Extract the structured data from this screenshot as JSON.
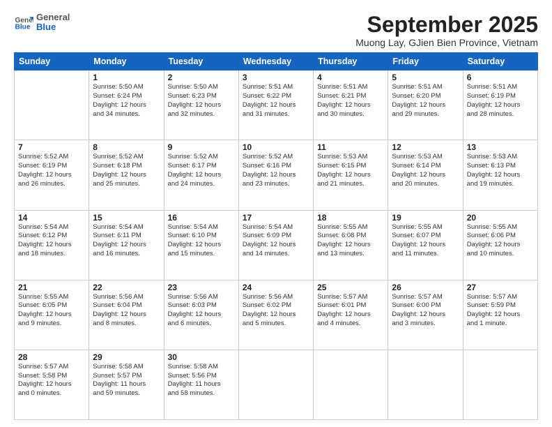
{
  "header": {
    "logo": {
      "general": "General",
      "blue": "Blue"
    },
    "title": "September 2025",
    "location": "Muong Lay, GJien Bien Province, Vietnam"
  },
  "weekdays": [
    "Sunday",
    "Monday",
    "Tuesday",
    "Wednesday",
    "Thursday",
    "Friday",
    "Saturday"
  ],
  "weeks": [
    [
      {
        "day": "",
        "lines": []
      },
      {
        "day": "1",
        "lines": [
          "Sunrise: 5:50 AM",
          "Sunset: 6:24 PM",
          "Daylight: 12 hours",
          "and 34 minutes."
        ]
      },
      {
        "day": "2",
        "lines": [
          "Sunrise: 5:50 AM",
          "Sunset: 6:23 PM",
          "Daylight: 12 hours",
          "and 32 minutes."
        ]
      },
      {
        "day": "3",
        "lines": [
          "Sunrise: 5:51 AM",
          "Sunset: 6:22 PM",
          "Daylight: 12 hours",
          "and 31 minutes."
        ]
      },
      {
        "day": "4",
        "lines": [
          "Sunrise: 5:51 AM",
          "Sunset: 6:21 PM",
          "Daylight: 12 hours",
          "and 30 minutes."
        ]
      },
      {
        "day": "5",
        "lines": [
          "Sunrise: 5:51 AM",
          "Sunset: 6:20 PM",
          "Daylight: 12 hours",
          "and 29 minutes."
        ]
      },
      {
        "day": "6",
        "lines": [
          "Sunrise: 5:51 AM",
          "Sunset: 6:19 PM",
          "Daylight: 12 hours",
          "and 28 minutes."
        ]
      }
    ],
    [
      {
        "day": "7",
        "lines": [
          "Sunrise: 5:52 AM",
          "Sunset: 6:19 PM",
          "Daylight: 12 hours",
          "and 26 minutes."
        ]
      },
      {
        "day": "8",
        "lines": [
          "Sunrise: 5:52 AM",
          "Sunset: 6:18 PM",
          "Daylight: 12 hours",
          "and 25 minutes."
        ]
      },
      {
        "day": "9",
        "lines": [
          "Sunrise: 5:52 AM",
          "Sunset: 6:17 PM",
          "Daylight: 12 hours",
          "and 24 minutes."
        ]
      },
      {
        "day": "10",
        "lines": [
          "Sunrise: 5:52 AM",
          "Sunset: 6:16 PM",
          "Daylight: 12 hours",
          "and 23 minutes."
        ]
      },
      {
        "day": "11",
        "lines": [
          "Sunrise: 5:53 AM",
          "Sunset: 6:15 PM",
          "Daylight: 12 hours",
          "and 21 minutes."
        ]
      },
      {
        "day": "12",
        "lines": [
          "Sunrise: 5:53 AM",
          "Sunset: 6:14 PM",
          "Daylight: 12 hours",
          "and 20 minutes."
        ]
      },
      {
        "day": "13",
        "lines": [
          "Sunrise: 5:53 AM",
          "Sunset: 6:13 PM",
          "Daylight: 12 hours",
          "and 19 minutes."
        ]
      }
    ],
    [
      {
        "day": "14",
        "lines": [
          "Sunrise: 5:54 AM",
          "Sunset: 6:12 PM",
          "Daylight: 12 hours",
          "and 18 minutes."
        ]
      },
      {
        "day": "15",
        "lines": [
          "Sunrise: 5:54 AM",
          "Sunset: 6:11 PM",
          "Daylight: 12 hours",
          "and 16 minutes."
        ]
      },
      {
        "day": "16",
        "lines": [
          "Sunrise: 5:54 AM",
          "Sunset: 6:10 PM",
          "Daylight: 12 hours",
          "and 15 minutes."
        ]
      },
      {
        "day": "17",
        "lines": [
          "Sunrise: 5:54 AM",
          "Sunset: 6:09 PM",
          "Daylight: 12 hours",
          "and 14 minutes."
        ]
      },
      {
        "day": "18",
        "lines": [
          "Sunrise: 5:55 AM",
          "Sunset: 6:08 PM",
          "Daylight: 12 hours",
          "and 13 minutes."
        ]
      },
      {
        "day": "19",
        "lines": [
          "Sunrise: 5:55 AM",
          "Sunset: 6:07 PM",
          "Daylight: 12 hours",
          "and 11 minutes."
        ]
      },
      {
        "day": "20",
        "lines": [
          "Sunrise: 5:55 AM",
          "Sunset: 6:06 PM",
          "Daylight: 12 hours",
          "and 10 minutes."
        ]
      }
    ],
    [
      {
        "day": "21",
        "lines": [
          "Sunrise: 5:55 AM",
          "Sunset: 6:05 PM",
          "Daylight: 12 hours",
          "and 9 minutes."
        ]
      },
      {
        "day": "22",
        "lines": [
          "Sunrise: 5:56 AM",
          "Sunset: 6:04 PM",
          "Daylight: 12 hours",
          "and 8 minutes."
        ]
      },
      {
        "day": "23",
        "lines": [
          "Sunrise: 5:56 AM",
          "Sunset: 6:03 PM",
          "Daylight: 12 hours",
          "and 6 minutes."
        ]
      },
      {
        "day": "24",
        "lines": [
          "Sunrise: 5:56 AM",
          "Sunset: 6:02 PM",
          "Daylight: 12 hours",
          "and 5 minutes."
        ]
      },
      {
        "day": "25",
        "lines": [
          "Sunrise: 5:57 AM",
          "Sunset: 6:01 PM",
          "Daylight: 12 hours",
          "and 4 minutes."
        ]
      },
      {
        "day": "26",
        "lines": [
          "Sunrise: 5:57 AM",
          "Sunset: 6:00 PM",
          "Daylight: 12 hours",
          "and 3 minutes."
        ]
      },
      {
        "day": "27",
        "lines": [
          "Sunrise: 5:57 AM",
          "Sunset: 5:59 PM",
          "Daylight: 12 hours",
          "and 1 minute."
        ]
      }
    ],
    [
      {
        "day": "28",
        "lines": [
          "Sunrise: 5:57 AM",
          "Sunset: 5:58 PM",
          "Daylight: 12 hours",
          "and 0 minutes."
        ]
      },
      {
        "day": "29",
        "lines": [
          "Sunrise: 5:58 AM",
          "Sunset: 5:57 PM",
          "Daylight: 11 hours",
          "and 59 minutes."
        ]
      },
      {
        "day": "30",
        "lines": [
          "Sunrise: 5:58 AM",
          "Sunset: 5:56 PM",
          "Daylight: 11 hours",
          "and 58 minutes."
        ]
      },
      {
        "day": "",
        "lines": []
      },
      {
        "day": "",
        "lines": []
      },
      {
        "day": "",
        "lines": []
      },
      {
        "day": "",
        "lines": []
      }
    ]
  ]
}
